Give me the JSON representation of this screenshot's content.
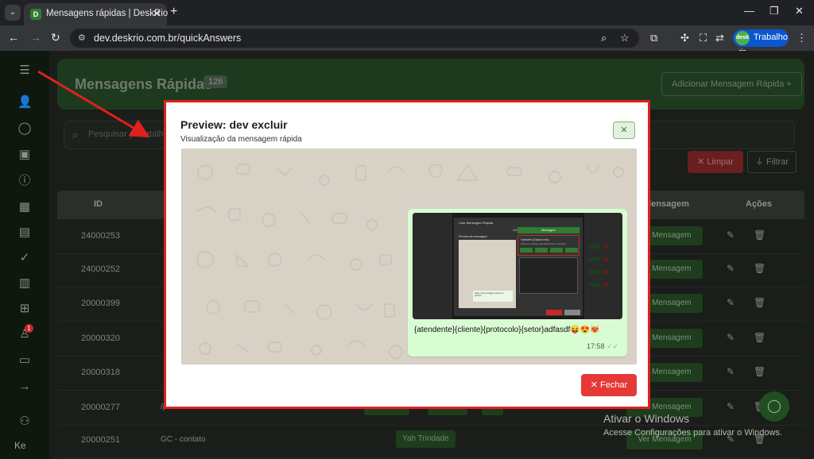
{
  "browser": {
    "tab_title": "Mensagens rápidas | DeskRio",
    "url": "dev.deskrio.com.br/quickAnswers",
    "profile_name": "Trabalho",
    "profile_avatar_text": "desk rio"
  },
  "sidebar": {
    "badge": "1",
    "user_initials": "Ke"
  },
  "header": {
    "title": "Mensagens Rápidas",
    "count": "126",
    "add_button": "Adicionar Mensagem Rápida +"
  },
  "search": {
    "placeholder": "Pesquisar por atalho ou mensagem"
  },
  "filters": {
    "clear_label": "✕  Limpar",
    "filter_label": "Filtrar"
  },
  "table": {
    "headers": {
      "id": "ID",
      "message": "Mensagem",
      "actions": "Ações"
    },
    "rows": [
      {
        "id": "24000253",
        "description": "",
        "tags": [],
        "view": "Ver Mensagem"
      },
      {
        "id": "24000252",
        "description": "",
        "tags": [],
        "view": "Ver Mensagem"
      },
      {
        "id": "20000399",
        "description": "",
        "tags": [],
        "view": "Ver Mensagem"
      },
      {
        "id": "20000320",
        "description": "",
        "tags": [],
        "view": "Ver Mensagem"
      },
      {
        "id": "20000318",
        "description": "",
        "tags": [],
        "view": "Ver Mensagem"
      },
      {
        "id": "20000277",
        "description": "/poscancelament...",
        "tags": [
          "brasil123",
          "Clustab",
          "+1"
        ],
        "view": "Ver Mensagem"
      },
      {
        "id": "20000251",
        "description": "GC - contato",
        "tags": [
          "Yah Trindade"
        ],
        "view": "Ver Mensagem"
      }
    ]
  },
  "watermark": {
    "title": "Ativar o Windows",
    "subtitle": "Acesse Configurações para ativar o Windows."
  },
  "modal": {
    "title": "Preview: dev excluir",
    "subtitle": "Visualização da mensagem rápida",
    "close_x": "✕",
    "message_text": "{atendente}{cliente}{protocolo}{setor}adfasdf😝😍😻",
    "message_time": "17:58",
    "ticks": "✓✓",
    "close_button": "✕  Fechar",
    "embedded_screenshot": {
      "title": "Criar Mensagem Rápida",
      "tab": "Geral",
      "preview_label": "Preview da mensagem",
      "preview_bubble": "Digite uma mensagem para ver o preview",
      "panel_head": "Mensagem",
      "red_box_title": "Variáveis (Disponíveis)",
      "red_box_sub": "Clique nas variáveis para adicioná-las à mensagem"
    }
  },
  "colors": {
    "brand_green": "#2e7d32",
    "close_red": "#e53935",
    "annotation_red": "#e0201e",
    "bubble_green": "#d9fdd3"
  }
}
